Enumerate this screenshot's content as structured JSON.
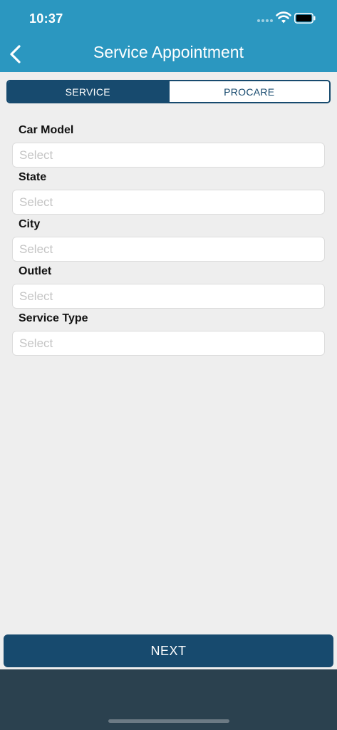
{
  "status_bar": {
    "time": "10:37"
  },
  "header": {
    "title": "Service Appointment"
  },
  "tabs": [
    {
      "label": "SERVICE",
      "active": true
    },
    {
      "label": "PROCARE",
      "active": false
    }
  ],
  "form": {
    "fields": [
      {
        "label": "Car Model",
        "placeholder": "Select",
        "value": ""
      },
      {
        "label": "State",
        "placeholder": "Select",
        "value": ""
      },
      {
        "label": "City",
        "placeholder": "Select",
        "value": ""
      },
      {
        "label": "Outlet",
        "placeholder": "Select",
        "value": ""
      },
      {
        "label": "Service Type",
        "placeholder": "Select",
        "value": ""
      }
    ]
  },
  "footer": {
    "next_label": "NEXT"
  },
  "colors": {
    "header_bg": "#2b97c0",
    "primary": "#174a6e",
    "page_bg": "#eeeeee",
    "bottom_bar": "#2b414f"
  },
  "icons": {
    "back": "chevron-left-icon",
    "wifi": "wifi-icon",
    "battery": "battery-icon",
    "signal": "signal-dots-icon"
  }
}
